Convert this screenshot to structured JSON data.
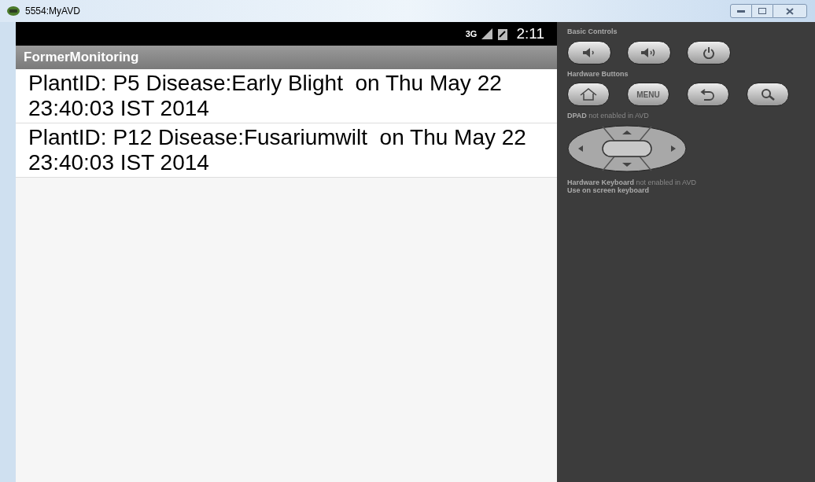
{
  "window": {
    "title": "5554:MyAVD"
  },
  "status_bar": {
    "network": "3G",
    "time": "2:11"
  },
  "app": {
    "title": "FormerMonitoring"
  },
  "list": [
    {
      "text": "PlantID: P5 Disease:Early Blight  on Thu May 22 23:40:03 IST 2014"
    },
    {
      "text": "PlantID: P12 Disease:Fusariumwilt  on Thu May 22 23:40:03 IST 2014"
    }
  ],
  "panel": {
    "basic_controls": "Basic Controls",
    "hardware_buttons": "Hardware Buttons",
    "menu_label": "MENU",
    "dpad_note": "**DPAD** not enabled in AVD",
    "keyboard_note": "**Hardware Keyboard** not enabled in AVD",
    "keyboard_hint": "Use on screen keyboard"
  }
}
